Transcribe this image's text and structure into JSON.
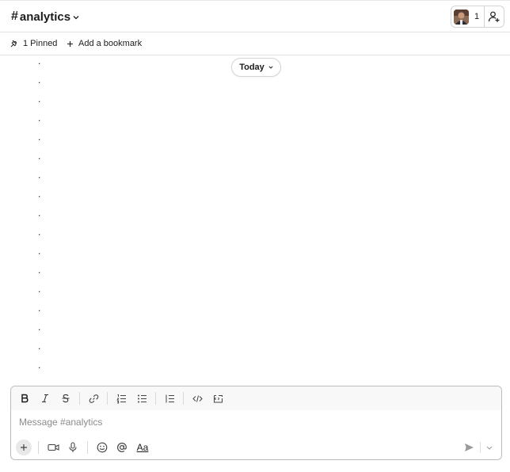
{
  "header": {
    "channel_hash": "#",
    "channel_name": "analytics",
    "member_count": "1"
  },
  "bookmarks": {
    "pinned_label": "1 Pinned",
    "add_bookmark_label": "Add a bookmark"
  },
  "messages": {
    "date_pill": "Today",
    "bullet": "."
  },
  "composer": {
    "placeholder": "Message #analytics",
    "format_label": "Aa"
  }
}
